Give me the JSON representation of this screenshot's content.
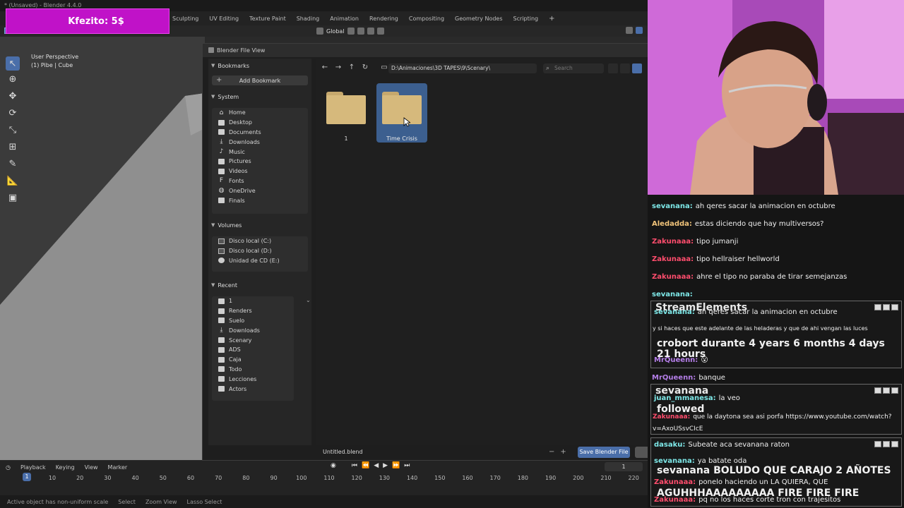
{
  "window_title": "* (Unsaved) - Blender 4.4.0",
  "donation": {
    "text": "Kfezito: 5$"
  },
  "workspace_tabs": [
    "Sculpting",
    "UV Editing",
    "Texture Paint",
    "Shading",
    "Animation",
    "Rendering",
    "Compositing",
    "Geometry Nodes",
    "Scripting"
  ],
  "header": {
    "orientation": "Global"
  },
  "viewport": {
    "perspective": "User Perspective",
    "object": "(1) Pibe | Cube"
  },
  "file_view": {
    "title": "Blender File View",
    "bookmarks": {
      "title": "Bookmarks",
      "add_label": "Add Bookmark"
    },
    "system": {
      "title": "System",
      "items": [
        "Home",
        "Desktop",
        "Documents",
        "Downloads",
        "Music",
        "Pictures",
        "Videos",
        "Fonts",
        "OneDrive",
        "Finals"
      ]
    },
    "volumes": {
      "title": "Volumes",
      "items": [
        "Disco local (C:)",
        "Disco local (D:)",
        "Unidad de CD (E:)"
      ]
    },
    "recent": {
      "title": "Recent",
      "items": [
        "1",
        "Renders",
        "Suelo",
        "Downloads",
        "Scenary",
        "ADS",
        "Caja",
        "Todo",
        "Lecciones",
        "Actors"
      ]
    },
    "path": "D:\\Animaciones\\3D TAPES\\9\\Scenary\\",
    "search_placeholder": "Search",
    "folders": [
      {
        "name": "1",
        "selected": false
      },
      {
        "name": "Time Crisis",
        "selected": true
      }
    ],
    "filename": "Untitled.blend",
    "save_label": "Save Blender File"
  },
  "timeline": {
    "menu": [
      "Playback",
      "Keying",
      "View",
      "Marker"
    ],
    "current_frame": "1",
    "frame_field": "1",
    "ticks": [
      "10",
      "20",
      "30",
      "40",
      "50",
      "60",
      "70",
      "80",
      "90",
      "100",
      "110",
      "120",
      "130",
      "140",
      "150",
      "160",
      "170",
      "180",
      "190",
      "200",
      "210",
      "220"
    ]
  },
  "status_bar": {
    "warning": "Active object has non-uniform scale",
    "select": "Select",
    "zoom": "Zoom View",
    "lasso": "Lasso Select"
  },
  "chat": {
    "messages": [
      {
        "user": "sevanana:",
        "user_color": "#7ee8e8",
        "text": "ah qeres sacar la animacion en octubre"
      },
      {
        "user": "Aledadda:",
        "user_color": "#f0c37a",
        "text": "estas diciendo que hay multiversos?"
      },
      {
        "user": "Zakunaaa:",
        "user_color": "#ff4d6d",
        "text": "tipo jumanji"
      },
      {
        "user": "Zakunaaa:",
        "user_color": "#ff4d6d",
        "text": "tipo hellraiser hellworld"
      },
      {
        "user": "Zakunaaa:",
        "user_color": "#ff4d6d",
        "text": "ahre el tipo no paraba de tirar semejanzas"
      },
      {
        "user": "sevanana:",
        "user_color": "#7ee8e8",
        "text": ""
      }
    ],
    "alert1": {
      "title": "StreamElements",
      "line1_user": "sevanana:",
      "line1": "ah qeres sacar la animacion en octubre",
      "line2": "y si haces que este adelante de las heladeras y que de ahi vengan las luces",
      "big": "crobort durante 4 years 6 months 4 days 21 hours",
      "line3_user": "MrQueenn:",
      "line3": "😮"
    },
    "msg_banque_user": "MrQueenn:",
    "msg_banque": "banque",
    "alert2": {
      "title": "sevanana",
      "line1_user": "juan_mmanesa:",
      "line1": "la veo",
      "line2_user": "Zakunaaa:",
      "line2": "que la daytona sea asi porfa",
      "line2_link": "https://www.youtube.com/watch?v=AxoUSsvCIcE",
      "big": "followed"
    },
    "alert3": {
      "line1_user": "dasaku:",
      "line1": "Subeate aca sevanana raton",
      "line2_user": "sevanana:",
      "line2": "ya batate oda",
      "big": "sevanana BOLUDO QUE CARAJO 2 AÑOTES",
      "line3_user": "Zakunaaa:",
      "line3": "ponelo haciendo un LA QUIERA, QUE",
      "big2": "AGUHHHAAAAAAAAA FIRE FIRE FIRE",
      "line4_user": "Zakunaaa:",
      "line4": "pq no los haces corte tron con trajesitos"
    }
  }
}
